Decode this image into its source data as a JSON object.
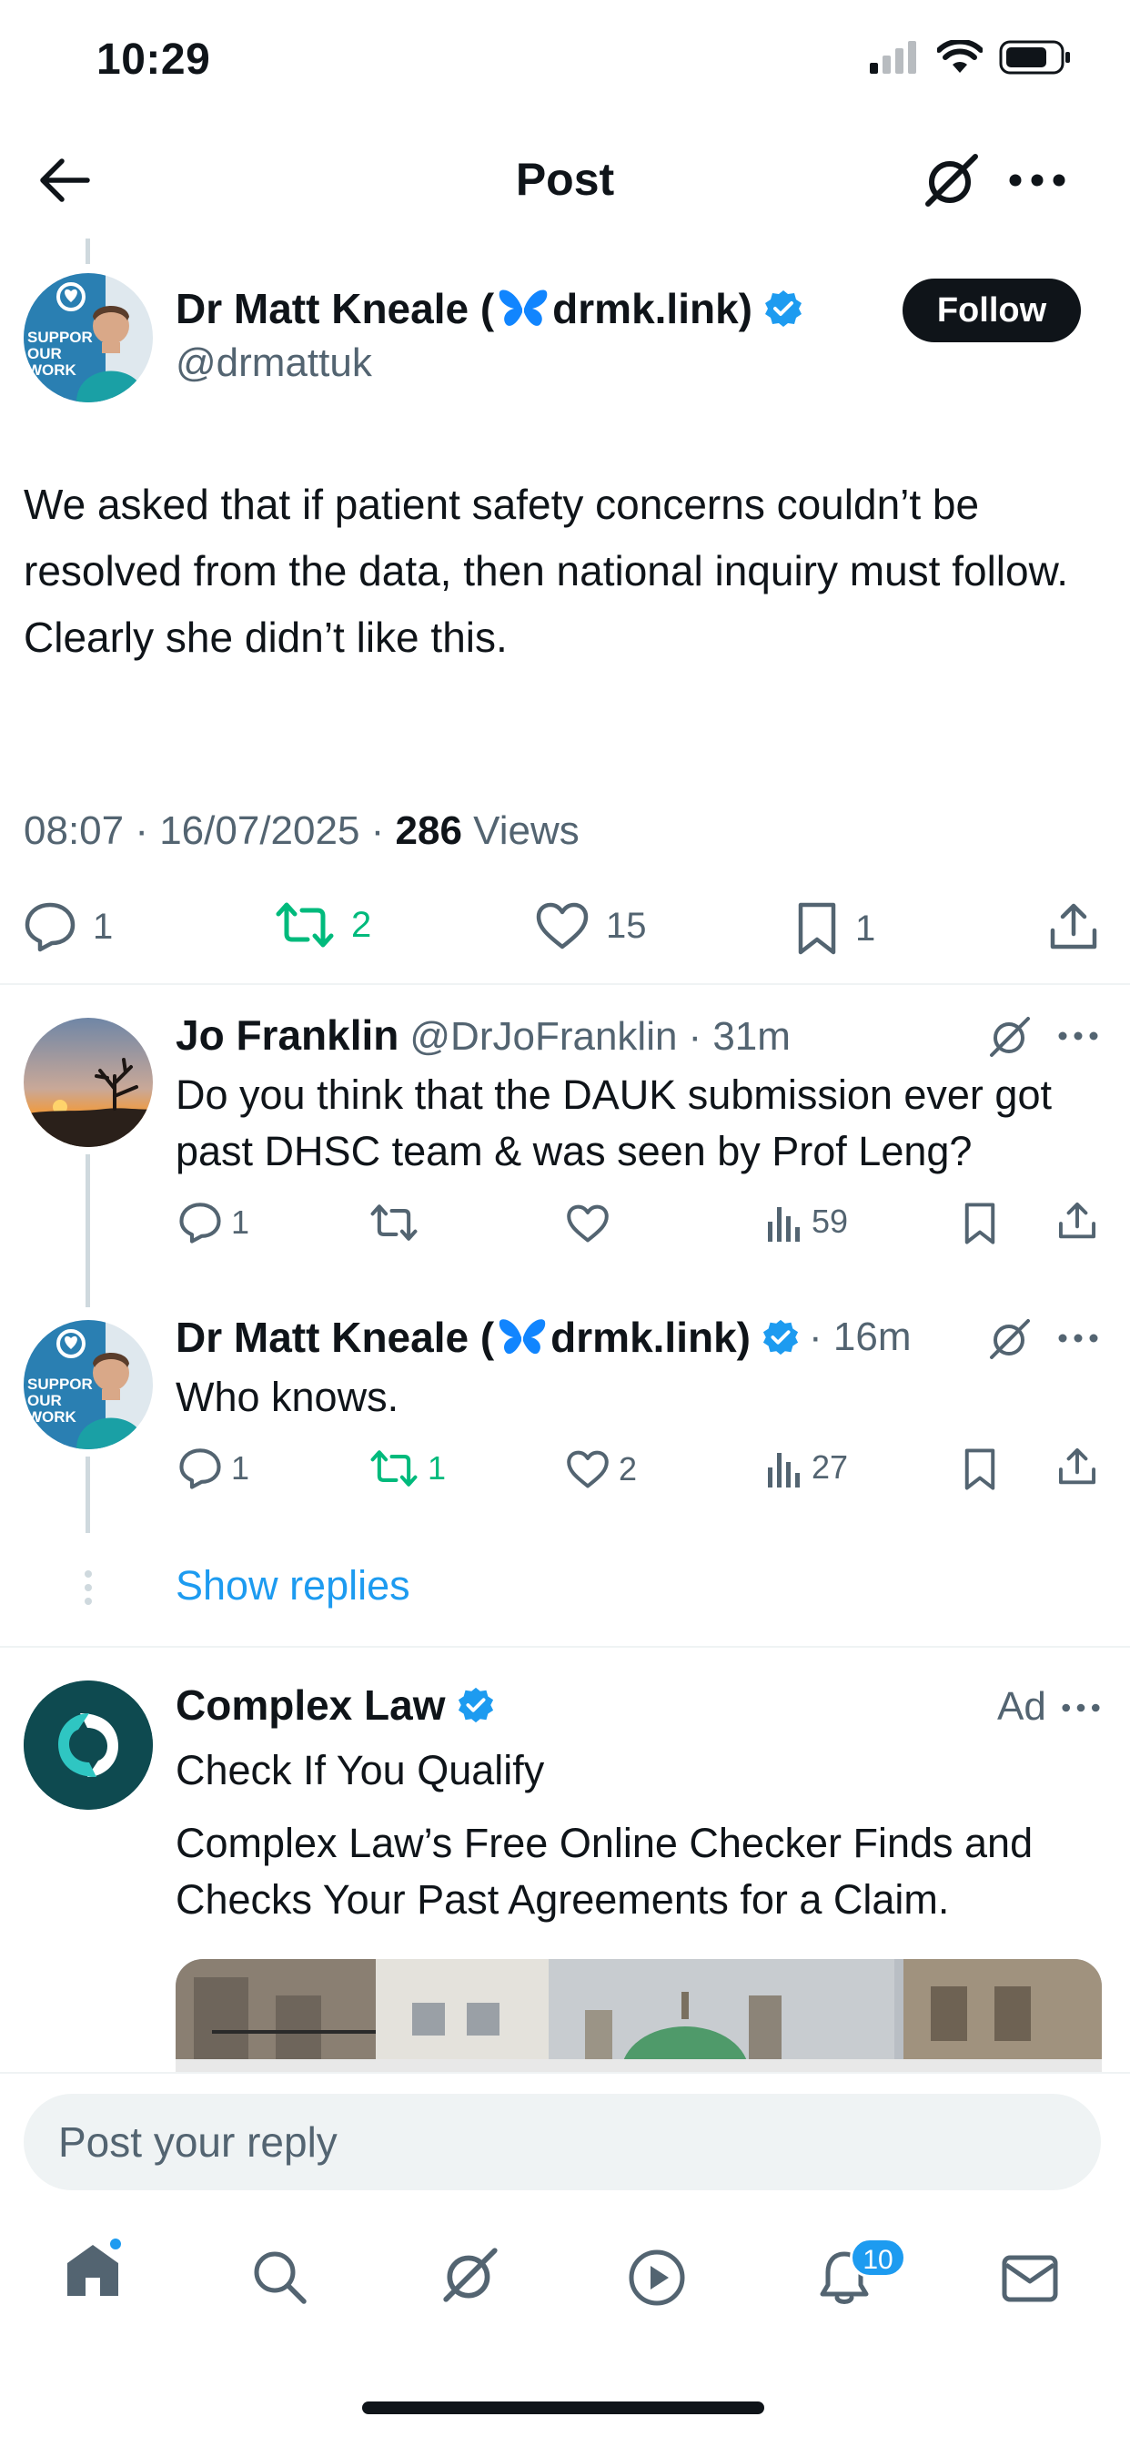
{
  "status_bar": {
    "time": "10:29"
  },
  "header": {
    "title": "Post"
  },
  "post": {
    "author_name": "Dr Matt Kneale (",
    "author_name_suffix": "drmk.link)",
    "handle": "@drmattuk",
    "follow_label": "Follow",
    "avatar_text": [
      "SUPPOR",
      "OUR",
      "WORK"
    ],
    "text": "We asked that if patient safety concerns couldn’t be resolved from the data, then national inquiry must follow. Clearly she didn’t like this.",
    "time": "08:07 · 16/07/2025 · ",
    "views_count": "286",
    "views_label": " Views",
    "stats": {
      "replies": "1",
      "reposts": "2",
      "likes": "15",
      "bookmarks": "1"
    }
  },
  "replies": [
    {
      "name": "Jo Franklin",
      "handle": "@DrJoFranklin",
      "time": "· 31m",
      "text": "Do you think that the DAUK submission ever got past DHSC team & was seen by Prof Leng?",
      "stats": {
        "replies": "1",
        "reposts": "",
        "likes": "",
        "views": "59"
      }
    },
    {
      "name": "Dr Matt Kneale (",
      "name_suffix": "drmk.link)",
      "time": "· 16m",
      "text": "Who knows.",
      "stats": {
        "replies": "1",
        "reposts": "1",
        "likes": "2",
        "views": "27"
      }
    }
  ],
  "show_replies_label": "Show replies",
  "ad": {
    "name": "Complex Law",
    "ad_label": "Ad",
    "headline": "Check If You Qualify",
    "body": "Complex Law’s Free Online Checker Finds and Checks Your Past Agreements for a Claim."
  },
  "reply_bar": {
    "placeholder": "Post your reply"
  },
  "tab_bar": {
    "notifications_badge": "10"
  },
  "colors": {
    "accent": "#1d9bf0",
    "repost_green": "#00ba7c",
    "text": "#0f1419",
    "secondary": "#536471"
  }
}
